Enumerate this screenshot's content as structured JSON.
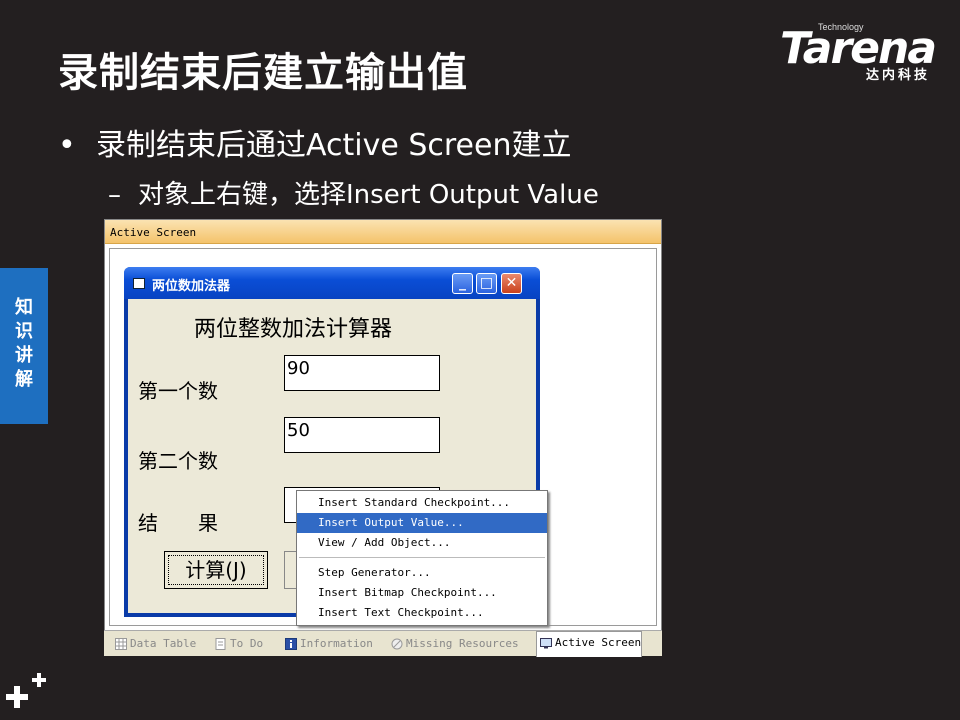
{
  "slide": {
    "title": "录制结束后建立输出值",
    "bullet1": "录制结束后通过Active Screen建立",
    "bullet1_marker": "•",
    "bullet2": "对象上右键，选择Insert  Output Value",
    "bullet2_marker": "–",
    "side_tab": [
      "知",
      "识",
      "讲",
      "解"
    ]
  },
  "logo": {
    "word": "Tarena",
    "tagline": "Technology",
    "subtitle": "达内科技"
  },
  "panel": {
    "title": "Active Screen"
  },
  "app_window": {
    "title": "两位数加法器",
    "heading": "两位整数加法计算器",
    "field1_label": "第一个数",
    "field1_value": "90",
    "field2_label": "第二个数",
    "field2_value": "50",
    "result_label": "结　　果",
    "result_value": "",
    "calc_button": "计算(J)",
    "minimize_glyph": "_",
    "maximize_glyph": "□",
    "close_glyph": "✕"
  },
  "context_menu": {
    "items": [
      "Insert Standard Checkpoint...",
      "Insert Output Value...",
      "View / Add Object...",
      "Step Generator...",
      "Insert Bitmap Checkpoint...",
      "Insert Text Checkpoint..."
    ],
    "selected_index": 1
  },
  "tabs": [
    {
      "label": "Data Table",
      "icon": "table-icon"
    },
    {
      "label": "To Do",
      "icon": "todo-icon"
    },
    {
      "label": "Information",
      "icon": "info-icon"
    },
    {
      "label": "Missing Resources",
      "icon": "missing-resources-icon"
    },
    {
      "label": "Active Screen",
      "icon": "active-screen-icon",
      "active": true
    }
  ],
  "colors": {
    "background": "#231f20",
    "side_tab": "#1e6fc0",
    "menu_highlight": "#316ac5",
    "xp_title_blue": "#0a4ed6"
  }
}
